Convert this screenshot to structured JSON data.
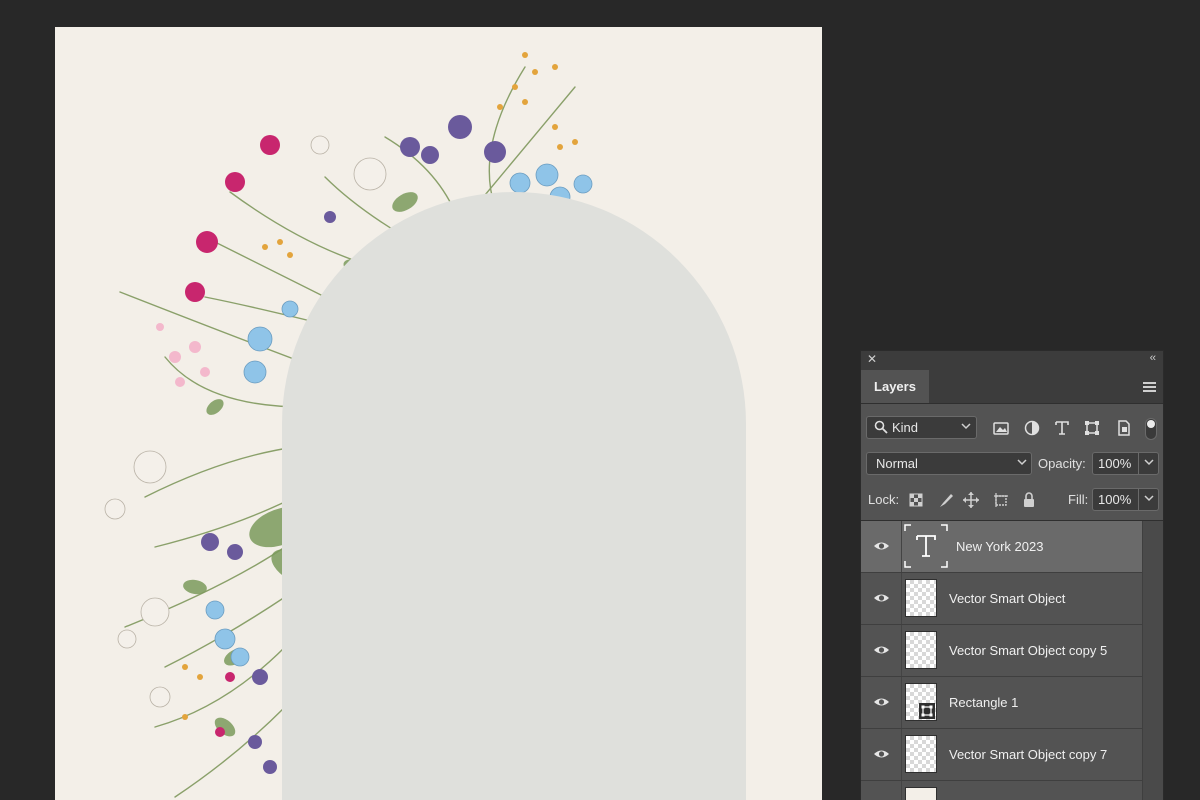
{
  "colors": {
    "workspace": "#282828",
    "canvas": "#f3efe8",
    "arch": "#dfe0dc",
    "panel": "#535353",
    "panel_header": "#3c3c3c",
    "selected_layer": "#6a6a6a"
  },
  "panel": {
    "tab_label": "Layers",
    "close_icon": "close-icon",
    "collapse_icon": "collapse-panel-icon",
    "menu_icon": "panel-menu-icon",
    "filter": {
      "kind_label": "Kind",
      "icons": [
        "image-filter-icon",
        "adjustment-filter-icon",
        "type-filter-icon",
        "shape-filter-icon",
        "smart-object-filter-icon"
      ]
    },
    "blend_mode": "Normal",
    "opacity_label": "Opacity:",
    "opacity_value": "100%",
    "lock_label": "Lock:",
    "lock_icons": [
      "lock-transparent-pixels-icon",
      "lock-image-pixels-icon",
      "lock-position-icon",
      "lock-artboard-icon",
      "lock-all-icon"
    ],
    "fill_label": "Fill:",
    "fill_value": "100%",
    "layers": [
      {
        "name": "New York 2023",
        "kind": "text",
        "visible": true,
        "selected": true
      },
      {
        "name": "Vector Smart Object",
        "kind": "smart",
        "visible": true,
        "selected": false
      },
      {
        "name": "Vector Smart Object copy 5",
        "kind": "smart",
        "visible": true,
        "selected": false
      },
      {
        "name": "Rectangle 1",
        "kind": "shape",
        "visible": true,
        "selected": false
      },
      {
        "name": "Vector Smart Object copy 7",
        "kind": "smart",
        "visible": true,
        "selected": false
      },
      {
        "name": "",
        "kind": "fill",
        "visible": true,
        "selected": false
      }
    ]
  }
}
